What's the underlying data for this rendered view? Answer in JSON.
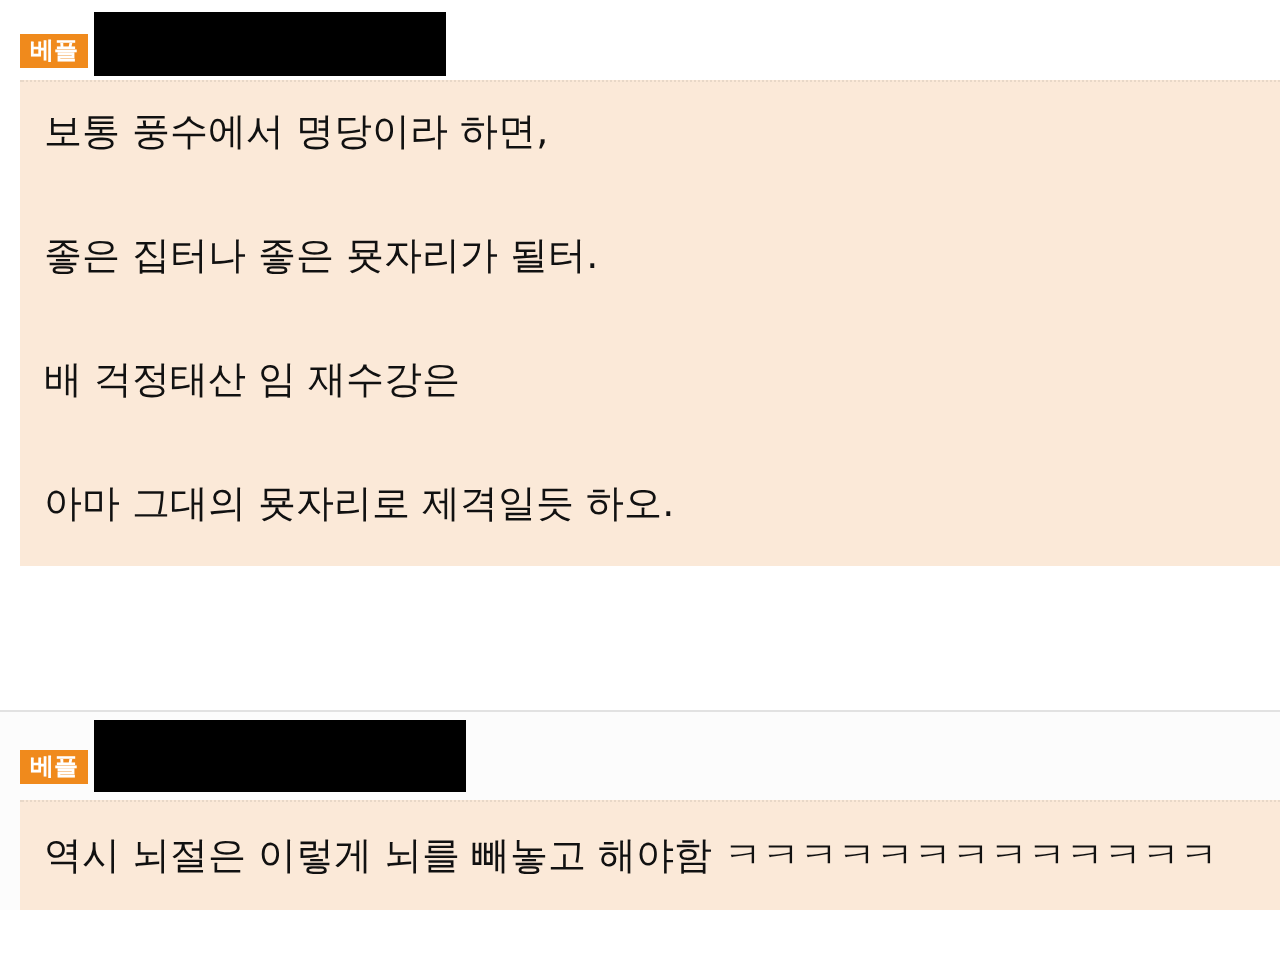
{
  "comments": [
    {
      "badge": "베플",
      "lines": [
        "보통 풍수에서 명당이라 하면,",
        "좋은 집터나 좋은 묫자리가 될터.",
        "배 걱정태산 임 재수강은",
        "아마 그대의 묫자리로 제격일듯 하오."
      ]
    },
    {
      "badge": "베플",
      "lines": [
        "역시 뇌절은 이렇게 뇌를 빼놓고 해야함 ㅋㅋㅋㅋㅋㅋㅋㅋㅋㅋㅋㅋㅋ"
      ]
    }
  ]
}
